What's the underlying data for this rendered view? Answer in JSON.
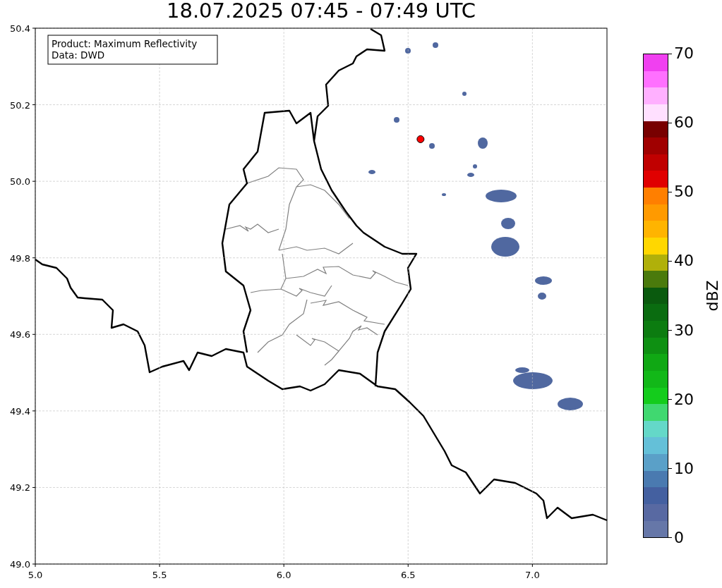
{
  "chart_data": {
    "type": "scatter",
    "title": "18.07.2025 07:45 - 07:49 UTC",
    "x": [
      6.55
    ],
    "series": [
      {
        "color": "#ff0000",
        "values": [
          50.11
        ]
      }
    ],
    "xlim": [
      5,
      7.3
    ],
    "ylim": [
      49,
      50.4
    ],
    "grid": true,
    "xticks": [
      {
        "value": 5,
        "label": "5.0"
      },
      {
        "value": 5.5,
        "label": "5.5"
      },
      {
        "value": 6,
        "label": "6.0"
      },
      {
        "value": 6.5,
        "label": "6.5"
      },
      {
        "value": 7,
        "label": "7.0"
      }
    ],
    "yticks": [
      {
        "value": 49,
        "label": "49.0"
      },
      {
        "value": 49.2,
        "label": "49.2"
      },
      {
        "value": 49.4,
        "label": "49.4"
      },
      {
        "value": 49.6,
        "label": "49.6"
      },
      {
        "value": 49.8,
        "label": "49.8"
      },
      {
        "value": 50,
        "label": "50.0"
      },
      {
        "value": 50.2,
        "label": "50.2"
      },
      {
        "value": 50.4,
        "label": "50.4"
      }
    ]
  },
  "info_box": [
    "Product: Maximum Reflectivity",
    "Data: DWD"
  ],
  "colorbar": {
    "label": "dBZ",
    "ticks": [
      "70",
      "60",
      "50",
      "40",
      "30",
      "20",
      "10",
      "0"
    ],
    "segments": [
      {
        "color": "#f040f0"
      },
      {
        "color": "#ff70ff"
      },
      {
        "color": "#ffb0ff"
      },
      {
        "color": "#ffe0ff"
      },
      {
        "color": "#780000"
      },
      {
        "color": "#a00000"
      },
      {
        "color": "#c00000"
      },
      {
        "color": "#e00000"
      },
      {
        "color": "#ff7f00"
      },
      {
        "color": "#ff9a00"
      },
      {
        "color": "#ffb400"
      },
      {
        "color": "#ffd700"
      },
      {
        "color": "#b0b00a"
      },
      {
        "color": "#4a7a0c"
      },
      {
        "color": "#0a5a0e"
      },
      {
        "color": "#0a6c10"
      },
      {
        "color": "#0c7c10"
      },
      {
        "color": "#0e9012"
      },
      {
        "color": "#10a814"
      },
      {
        "color": "#12b818"
      },
      {
        "color": "#14cc1c"
      },
      {
        "color": "#40d870"
      },
      {
        "color": "#64d8c8"
      },
      {
        "color": "#64c0d8"
      },
      {
        "color": "#5aa0c8"
      },
      {
        "color": "#4a7ab0"
      },
      {
        "color": "#4460a0"
      },
      {
        "color": "#5869a2"
      },
      {
        "color": "#6677a8"
      }
    ]
  }
}
